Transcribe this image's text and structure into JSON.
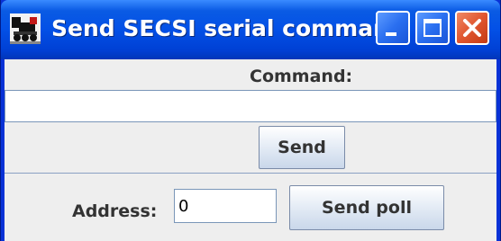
{
  "window": {
    "title": "Send SECSI serial command",
    "title_bar_color": "#0350e6",
    "close_button_color": "#e0562f",
    "app_icon": "locomotive-icon"
  },
  "form": {
    "command_label": "Command:",
    "command_value": "",
    "send_label": "Send",
    "address_label": "Address:",
    "address_value": "0",
    "send_poll_label": "Send poll"
  }
}
